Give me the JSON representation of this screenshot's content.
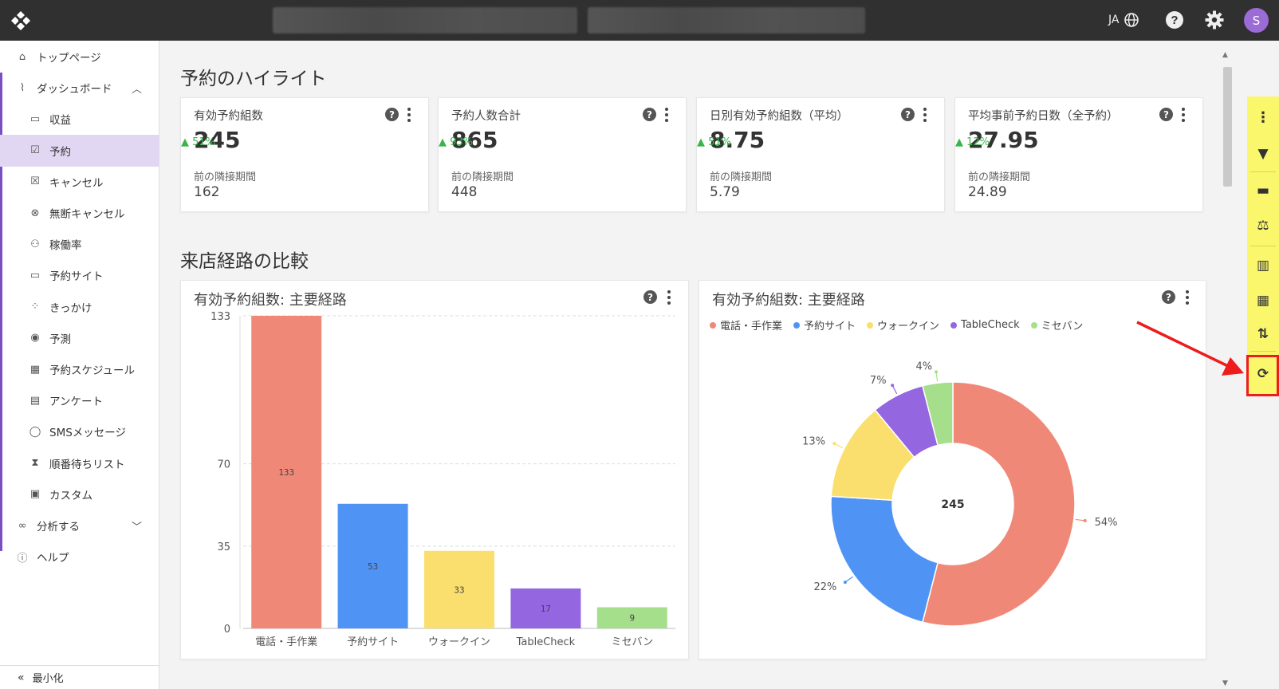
{
  "header": {
    "lang": "JA",
    "avatar_initial": "S"
  },
  "sidebar": {
    "items": [
      {
        "label": "トップページ",
        "icon": "home-icon",
        "level": "top"
      },
      {
        "label": "ダッシュボード",
        "icon": "chart-line-icon",
        "level": "top",
        "expanded": true
      },
      {
        "label": "収益",
        "icon": "money-icon",
        "level": "sub"
      },
      {
        "label": "予約",
        "icon": "calendar-check-icon",
        "level": "sub",
        "active": true
      },
      {
        "label": "キャンセル",
        "icon": "calendar-x-icon",
        "level": "sub"
      },
      {
        "label": "無断キャンセル",
        "icon": "circle-x-icon",
        "level": "sub"
      },
      {
        "label": "稼働率",
        "icon": "people-icon",
        "level": "sub"
      },
      {
        "label": "予約サイト",
        "icon": "monitor-icon",
        "level": "sub"
      },
      {
        "label": "きっかけ",
        "icon": "nodes-icon",
        "level": "sub"
      },
      {
        "label": "予測",
        "icon": "eye-icon",
        "level": "sub"
      },
      {
        "label": "予約スケジュール",
        "icon": "calendar-icon",
        "level": "sub"
      },
      {
        "label": "アンケート",
        "icon": "document-icon",
        "level": "sub"
      },
      {
        "label": "SMSメッセージ",
        "icon": "chat-icon",
        "level": "sub"
      },
      {
        "label": "順番待ちリスト",
        "icon": "hourglass-icon",
        "level": "sub"
      },
      {
        "label": "カスタム",
        "icon": "custom-chart-icon",
        "level": "sub"
      },
      {
        "label": "分析する",
        "icon": "binoculars-icon",
        "level": "top",
        "expanded": false
      },
      {
        "label": "ヘルプ",
        "icon": "help-circle-icon",
        "level": "top"
      }
    ],
    "footer_label": "最小化"
  },
  "main": {
    "highlights_title": "予約のハイライト",
    "kpis": [
      {
        "title": "有効予約組数",
        "value": "245",
        "change": "51%",
        "prev_label": "前の隣接期間",
        "prev_value": "162"
      },
      {
        "title": "予約人数合計",
        "value": "865",
        "change": "93%",
        "prev_label": "前の隣接期間",
        "prev_value": "448"
      },
      {
        "title": "日別有効予約組数（平均）",
        "value": "8.75",
        "change": "51%",
        "prev_label": "前の隣接期間",
        "prev_value": "5.79"
      },
      {
        "title": "平均事前予約日数（全予約）",
        "value": "27.95",
        "change": "12%",
        "prev_label": "前の隣接期間",
        "prev_value": "24.89"
      }
    ],
    "comparison_title": "来店経路の比較",
    "bar_card_title": "有効予約組数: 主要経路",
    "pie_card_title": "有効予約組数: 主要経路"
  },
  "chart_data": [
    {
      "type": "bar",
      "categories": [
        "電話・手作業",
        "予約サイト",
        "ウォークイン",
        "TableCheck",
        "ミセバン"
      ],
      "values": [
        133,
        53,
        33,
        17,
        9
      ],
      "colors": [
        "#f08878",
        "#4f94f5",
        "#fadf6e",
        "#9466e0",
        "#a6df8c"
      ],
      "yticks": [
        0,
        35,
        70,
        133
      ],
      "ylim": [
        0,
        133
      ],
      "grid": true,
      "title": "有効予約組数: 主要経路"
    },
    {
      "type": "pie",
      "donut": true,
      "center_label": "245",
      "labels": [
        "電話・手作業",
        "予約サイト",
        "ウォークイン",
        "TableCheck",
        "ミセバン"
      ],
      "values": [
        54,
        22,
        13,
        7,
        4
      ],
      "value_labels": [
        "54%",
        "22%",
        "13%",
        "7%",
        "4%"
      ],
      "colors": [
        "#f08878",
        "#4f94f5",
        "#fadf6e",
        "#9466e0",
        "#a6df8c"
      ],
      "legend_position": "top-left",
      "title": "有効予約組数: 主要経路"
    }
  ],
  "toolbar": {
    "buttons": [
      "more-icon",
      "filter-icon",
      "calendar-icon",
      "scale-icon",
      "bar-chart-icon",
      "grid-icon",
      "sort-icon",
      "refresh-icon"
    ],
    "accent": "#fbf76c",
    "highlight_color": "#ee1c1c"
  }
}
